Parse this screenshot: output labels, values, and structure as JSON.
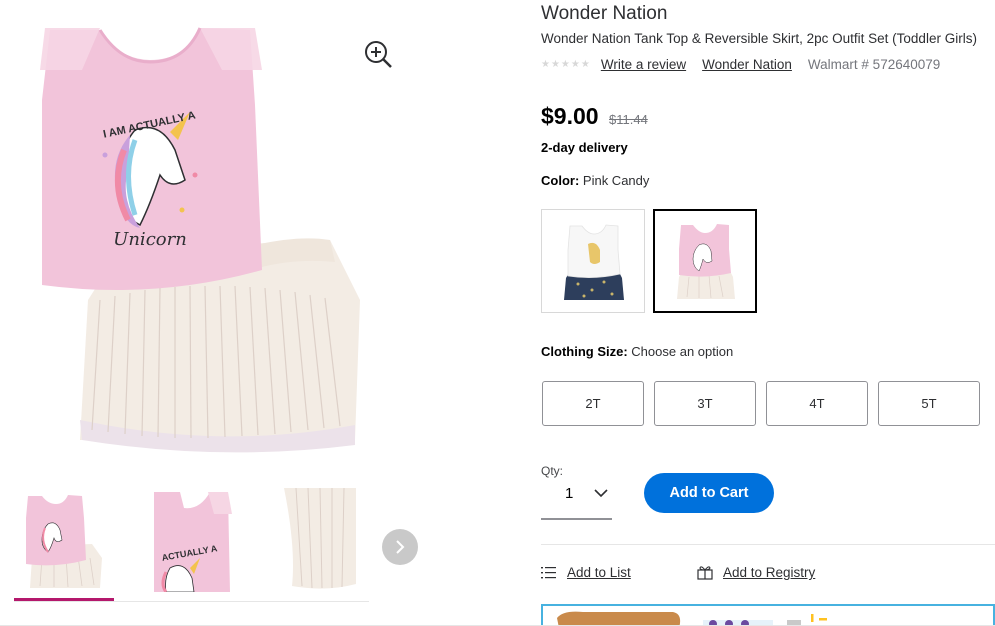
{
  "product": {
    "brand": "Wonder Nation",
    "title": "Wonder Nation Tank Top & Reversible Skirt, 2pc Outfit Set (Toddler Girls)",
    "stars": "★★★★★",
    "write_review": "Write a review",
    "brand_link": "Wonder Nation",
    "sku": "Walmart # 572640079",
    "price": "$9.00",
    "was_price": "$11.44",
    "delivery": "2-day delivery"
  },
  "color": {
    "label": "Color:",
    "value": "Pink Candy"
  },
  "sizes": {
    "label": "Clothing Size:",
    "prompt": "Choose an option",
    "options": [
      "2T",
      "3T",
      "4T",
      "5T"
    ]
  },
  "quantity": {
    "label": "Qty:",
    "value": "1"
  },
  "actions": {
    "add_to_cart": "Add to Cart",
    "add_to_list": "Add to List",
    "add_to_registry": "Add to Registry"
  },
  "graphic_text": {
    "shirt_line1": "I AM ACTUALLY A",
    "shirt_line2": "Unicorn"
  },
  "colors": {
    "accent": "#0071dc",
    "thumb_active": "#b4186c",
    "shirt_pink": "#f2c4da",
    "banner_border": "#47b2e0"
  }
}
